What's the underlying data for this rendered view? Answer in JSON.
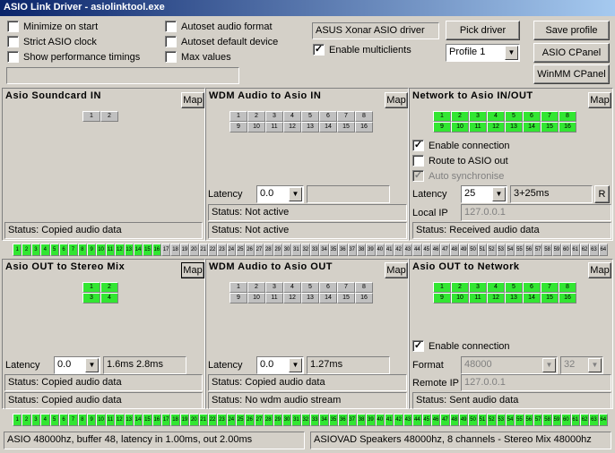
{
  "window": {
    "title": "ASIO Link Driver - asiolinktool.exe"
  },
  "options": {
    "minimize_on_start": {
      "label": "Minimize on start",
      "checked": false
    },
    "strict_asio_clock": {
      "label": "Strict ASIO clock",
      "checked": false
    },
    "show_performance_timings": {
      "label": "Show performance timings",
      "checked": false
    },
    "autoset_audio_format": {
      "label": "Autoset audio format",
      "checked": false
    },
    "autoset_default_device": {
      "label": "Autoset default device",
      "checked": false
    },
    "max_values": {
      "label": "Max values",
      "checked": false
    },
    "perf_field": ""
  },
  "driver": {
    "name": "ASUS Xonar ASIO driver",
    "enable_multiclients": {
      "label": "Enable multiclients",
      "checked": true
    },
    "pick_driver_label": "Pick driver",
    "profile_value": "Profile 1",
    "save_profile_label": "Save profile",
    "asio_cpanel_label": "ASIO CPanel",
    "winmm_cpanel_label": "WinMM CPanel"
  },
  "map_label": "Map",
  "panels": {
    "asio_soundcard_in": {
      "title": "Asio Soundcard IN",
      "channels": [
        "1",
        "2"
      ],
      "status": "Status: Copied audio data"
    },
    "wdm_to_asio_in": {
      "title": "WDM Audio to Asio IN",
      "channels": [
        "1",
        "2",
        "3",
        "4",
        "5",
        "6",
        "7",
        "8",
        "9",
        "10",
        "11",
        "12",
        "13",
        "14",
        "15",
        "16"
      ],
      "latency_label": "Latency",
      "latency_value": "0.0",
      "latency_info": "",
      "status1": "Status: Not active",
      "status2": "Status: Not active"
    },
    "network_io": {
      "title": "Network to Asio IN/OUT",
      "channels": [
        "1",
        "2",
        "3",
        "4",
        "5",
        "6",
        "7",
        "8",
        "9",
        "10",
        "11",
        "12",
        "13",
        "14",
        "15",
        "16"
      ],
      "enable_connection": {
        "label": "Enable connection",
        "checked": true
      },
      "route_to_asio_out": {
        "label": "Route to ASIO out",
        "checked": false
      },
      "auto_synchronise": {
        "label": "Auto synchronise",
        "checked": true
      },
      "latency_label": "Latency",
      "latency_value": "25",
      "latency_info": "3+25ms",
      "r_button": "R",
      "local_ip_label": "Local IP",
      "local_ip_value": "127.0.0.1",
      "status": "Status: Received audio data"
    },
    "asio_out_stereo_mix": {
      "title": "Asio OUT to Stereo Mix",
      "channels": [
        "1",
        "2",
        "3",
        "4"
      ],
      "latency_label": "Latency",
      "latency_value": "0.0",
      "latency_info": "1.6ms 2.8ms",
      "status1": "Status: Copied audio data",
      "status2": "Status: Copied audio data"
    },
    "wdm_to_asio_out": {
      "title": "WDM Audio to Asio OUT",
      "channels": [
        "1",
        "2",
        "3",
        "4",
        "5",
        "6",
        "7",
        "8",
        "9",
        "10",
        "11",
        "12",
        "13",
        "14",
        "15",
        "16"
      ],
      "latency_label": "Latency",
      "latency_value": "0.0",
      "latency_info": "1.27ms",
      "status1": "Status: Copied audio data",
      "status2": "Status: No wdm audio stream"
    },
    "asio_out_network": {
      "title": "Asio OUT to Network",
      "channels": [
        "1",
        "2",
        "3",
        "4",
        "5",
        "6",
        "7",
        "8",
        "9",
        "10",
        "11",
        "12",
        "13",
        "14",
        "15",
        "16"
      ],
      "enable_connection": {
        "label": "Enable connection",
        "checked": true
      },
      "format_label": "Format",
      "format_value": "48000",
      "format_bits": "32",
      "remote_ip_label": "Remote IP",
      "remote_ip_value": "127.0.0.1",
      "status": "Status: Sent audio data"
    }
  },
  "strip_top": {
    "count": 64,
    "active": 16
  },
  "strip_bottom": {
    "count": 64,
    "active": 64
  },
  "statusbar": {
    "left": "ASIO 48000hz, buffer 48, latency in 1.00ms, out 2.00ms",
    "right": "ASIOVAD Speakers 48000hz, 8 channels - Stereo Mix 48000hz"
  },
  "colors": {
    "active_channel": "#32e632",
    "title_bar": "#0a246a"
  }
}
